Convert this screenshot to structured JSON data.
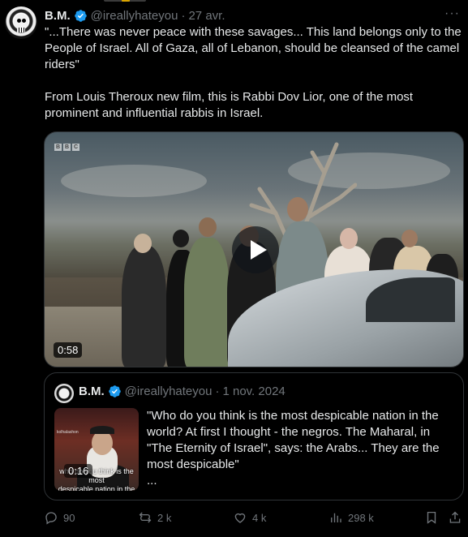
{
  "tweet": {
    "author_name": "B.M.",
    "author_handle": "@ireallyhateyou",
    "separator": "·",
    "date": "27 avr.",
    "more_label": "···",
    "text": "\"...There was never peace with these savages... This land belongs only to the People of Israel. All of Gaza, all of Lebanon, should be cleansed of the camel riders\"\n\nFrom Louis Theroux new film, this is Rabbi Dov Lior, one of the most prominent and influential rabbis in Israel.",
    "video": {
      "watermark": [
        "B",
        "B",
        "C"
      ],
      "duration": "0:58"
    }
  },
  "quoted_tweet": {
    "author_name": "B.M.",
    "author_handle": "@ireallyhateyou",
    "separator": "·",
    "date": "1 nov. 2024",
    "text": "\"Who do you think is the most despicable nation in the world? At first I thought - the negros. The Maharal, in \"The Eternity of Israel\", says: the Arabs... They are the most despicable\"\n...",
    "thumbnail": {
      "duration": "0:16",
      "subtitle": "who do you think is the most\ndespicable nation in the world",
      "logo_text": "kolhalashon"
    }
  },
  "actions": {
    "replies": "90",
    "reposts": "2 k",
    "likes": "4 k",
    "views": "298 k"
  },
  "colors": {
    "background": "#000000",
    "text_primary": "#e7e9ea",
    "text_secondary": "#71767b",
    "verified_badge": "#1d9bf0",
    "border": "#2f3336"
  },
  "icons": [
    "verified-badge-icon",
    "more-icon",
    "play-icon",
    "reply-icon",
    "repost-icon",
    "like-icon",
    "views-icon",
    "bookmark-icon",
    "share-icon"
  ]
}
